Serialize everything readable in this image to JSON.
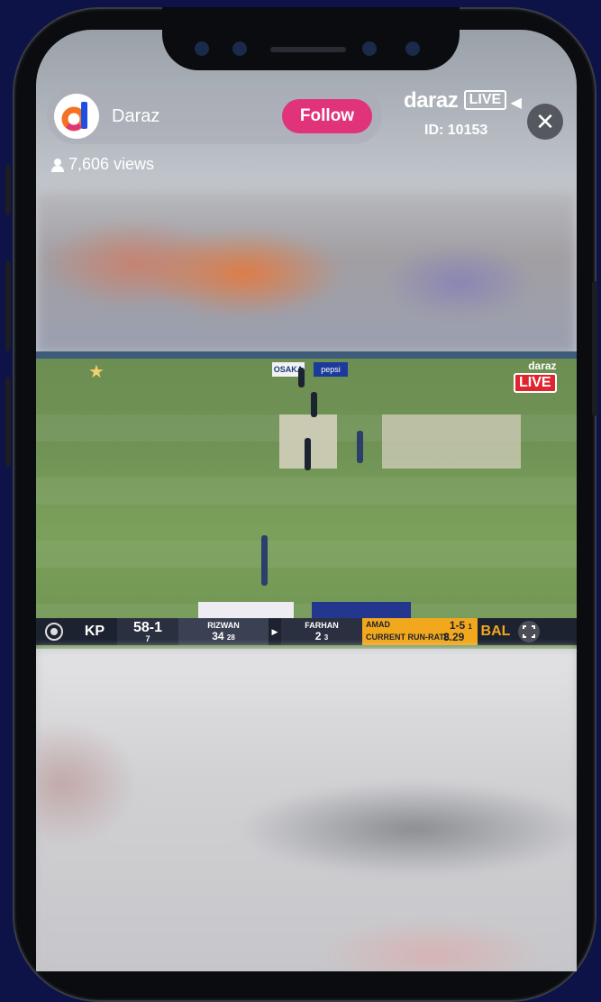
{
  "header": {
    "channel_name": "Daraz",
    "avatar_letter": "d",
    "follow_label": "Follow",
    "views_count": "7,606 views"
  },
  "brand": {
    "wordmark": "daraz",
    "live_label": "LIVE",
    "live_id": "ID: 10153"
  },
  "controls": {
    "close_symbol": "✕"
  },
  "video_overlay": {
    "brand_small": "daraz",
    "live_label": "LIVE",
    "billboard_left": "OSAKA",
    "billboard_right": "pepsi"
  },
  "scoreboard": {
    "team_left": "KP",
    "score": "58-1",
    "overs": "7",
    "batter1_name": "RIZWAN",
    "batter1_runs": "34",
    "batter1_balls": "28",
    "batter2_name": "FARHAN",
    "batter2_runs": "2",
    "batter2_balls": "3",
    "bowler_name": "AMAD",
    "bowler_figures": "1-5",
    "bowler_overs": "1",
    "run_rate_label": "CURRENT RUN-RATE",
    "run_rate_value": "8.29",
    "team_right": "BAL"
  },
  "colors": {
    "follow": "#e0337a",
    "live_red": "#e1252f",
    "scoreboard_orange": "#f2a81d",
    "background": "#0e1347"
  }
}
